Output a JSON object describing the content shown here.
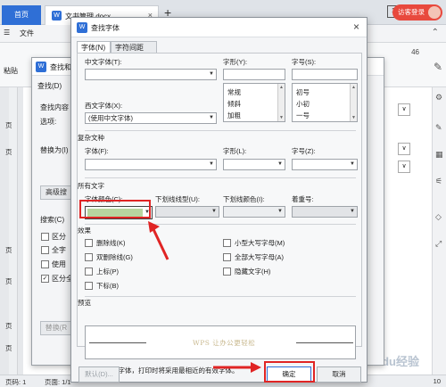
{
  "wps": {
    "home_tab": "首页",
    "doc_tab": "文书管理.docx",
    "tab_close": "×",
    "new_tab": "+",
    "badge": "1",
    "visitor_login": "访客登录",
    "menu_icon": "☰",
    "menu_file": "文件",
    "paste": "粘贴",
    "zoom_right": "46",
    "status_page": "页码: 1",
    "status_pages": "页面: 1/1",
    "status_zoom": "10",
    "page_refs": [
      "页",
      "页",
      "页",
      "页",
      "页",
      "页"
    ],
    "watermark": "Baidu经验",
    "right_rail_dropdowns": [
      "∨",
      "∨",
      "∨"
    ]
  },
  "find_replace": {
    "title": "查找和替换",
    "tab_find": "查找(D)",
    "find_content_label": "查找内容",
    "options_label": "选项:",
    "replace_label": "替换为(I)",
    "advanced_button": "高级搜",
    "search_label": "搜索(C)",
    "checks": [
      "区分",
      "全字",
      "使用",
      "区分全"
    ],
    "replace_button": "替换(R",
    "bottom_button": "替换(R)"
  },
  "find_font": {
    "title": "查找字体",
    "close": "×",
    "tabs": [
      "字体(N)",
      "字符间距(R)"
    ],
    "labels": {
      "chinese_font": "中文字体(T):",
      "style": "字形(Y):",
      "size": "字号(S):",
      "western_font": "西文字体(X):",
      "complex_section": "复杂文种",
      "complex_font": "字体(F):",
      "complex_style": "字形(L):",
      "complex_size": "字号(Z):",
      "all_text_section": "所有文字",
      "font_color": "字体颜色(C):",
      "underline_type": "下划线线型(U):",
      "underline_color": "下划线颜色(I):",
      "emphasis": "着重号:",
      "effects_section": "效果",
      "preview_section": "预览"
    },
    "western_font_value": "(使用中文字体)",
    "style_list": [
      "常规",
      "倾斜",
      "加粗"
    ],
    "size_list": [
      "初号",
      "小初",
      "一号"
    ],
    "effects_left": [
      "删除线(K)",
      "双删除线(G)",
      "上标(P)",
      "下标(B)"
    ],
    "effects_right": [
      "小型大写字母(M)",
      "全部大写字母(A)",
      "隐藏文字(H)"
    ],
    "preview_text": "WPS 让办公更轻松",
    "note": "尚未安装此字体，打印时将采用最相近的有效字体。",
    "buttons": {
      "default": "默认(D)...",
      "ok": "确定",
      "cancel": "取消"
    },
    "font_color_swatch": "#b7d59f"
  },
  "colors": {
    "accent_blue": "#2f6fd6",
    "highlight_red": "#e02424",
    "visitor_red": "#e8493d"
  }
}
